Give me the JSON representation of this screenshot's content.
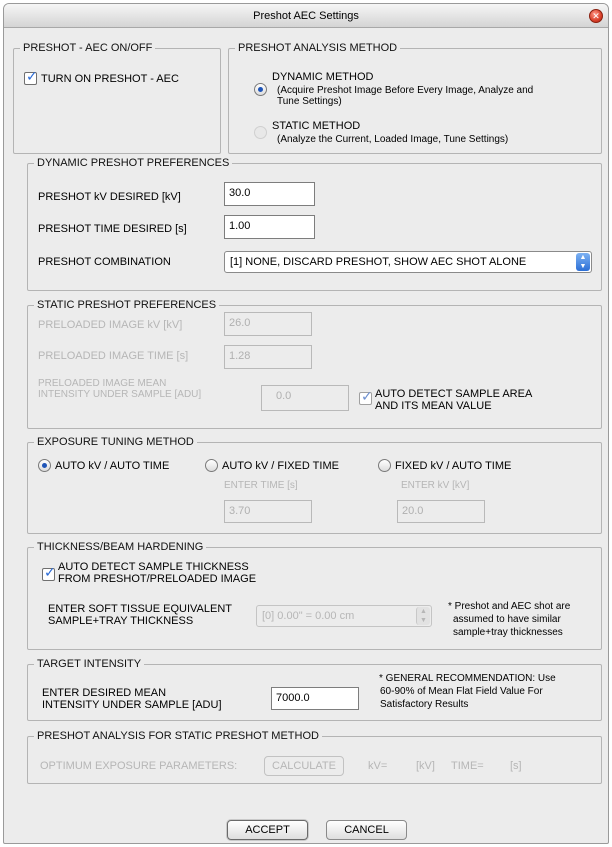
{
  "window": {
    "title": "Preshot AEC Settings"
  },
  "aec_onoff": {
    "legend": "PRESHOT - AEC ON/OFF",
    "turn_on_label": "TURN ON PRESHOT - AEC",
    "turn_on_checked": true
  },
  "analysis_method": {
    "legend": "PRESHOT ANALYSIS METHOD",
    "dynamic_title": "DYNAMIC METHOD",
    "dynamic_desc1": "(Acquire Preshot Image Before Every Image, Analyze and",
    "dynamic_desc2": "Tune Settings)",
    "static_title": "STATIC METHOD",
    "static_desc": "(Analyze the Current, Loaded Image, Tune Settings)",
    "selected": "dynamic"
  },
  "dynamic_prefs": {
    "legend": "DYNAMIC PRESHOT PREFERENCES",
    "kv_label": "PRESHOT kV DESIRED  [kV]",
    "kv_value": "30.0",
    "time_label": "PRESHOT TIME DESIRED  [s]",
    "time_value": "1.00",
    "combination_label": "PRESHOT COMBINATION",
    "combination_value": "[1] NONE, DISCARD PRESHOT, SHOW AEC SHOT ALONE"
  },
  "static_prefs": {
    "legend": "STATIC PRESHOT PREFERENCES",
    "kv_label": "PRELOADED IMAGE kV  [kV]",
    "kv_value": "26.0",
    "time_label": "PRELOADED IMAGE TIME [s]",
    "time_value": "1.28",
    "mean_label1": "PRELOADED IMAGE MEAN",
    "mean_label2": "INTENSITY UNDER SAMPLE   [ADU]",
    "mean_value": "0.0",
    "auto_detect_label1": "AUTO DETECT SAMPLE AREA",
    "auto_detect_label2": "AND ITS MEAN VALUE",
    "auto_detect_checked": true
  },
  "exposure_tuning": {
    "legend": "EXPOSURE TUNING METHOD",
    "opt1": "AUTO kV / AUTO TIME",
    "opt2": "AUTO kV / FIXED TIME",
    "opt3": "FIXED kV / AUTO TIME",
    "selected": "opt1",
    "enter_time_label": "ENTER TIME  [s]",
    "enter_time_value": "3.70",
    "enter_kv_label": "ENTER kV  [kV]",
    "enter_kv_value": "20.0"
  },
  "thickness": {
    "legend": "THICKNESS/BEAM HARDENING",
    "auto_label1": "AUTO DETECT SAMPLE THICKNESS",
    "auto_label2": "FROM PRESHOT/PRELOADED IMAGE",
    "auto_checked": true,
    "enter_label1": "ENTER SOFT TISSUE EQUIVALENT",
    "enter_label2": "SAMPLE+TRAY THICKNESS",
    "select_value": "[0]   0.00\" = 0.00 cm",
    "note1": "* Preshot and AEC shot are",
    "note2": "assumed to have similar",
    "note3": "sample+tray thicknesses"
  },
  "target_intensity": {
    "legend": "TARGET INTENSITY",
    "label1": "ENTER DESIRED MEAN",
    "label2": "INTENSITY UNDER SAMPLE  [ADU]",
    "value": "7000.0",
    "rec1": "* GENERAL RECOMMENDATION: Use",
    "rec2": "60-90% of Mean Flat Field Value For",
    "rec3": "Satisfactory Results"
  },
  "static_analysis": {
    "legend": "PRESHOT ANALYSIS FOR STATIC PRESHOT METHOD",
    "optimum_label": "OPTIMUM EXPOSURE PARAMETERS:",
    "calculate_label": "CALCULATE",
    "kv_label": "kV=",
    "kv_unit": "[kV]",
    "time_label": "TIME=",
    "time_unit": "[s]"
  },
  "footer": {
    "accept_label": "ACCEPT",
    "cancel_label": "CANCEL"
  }
}
